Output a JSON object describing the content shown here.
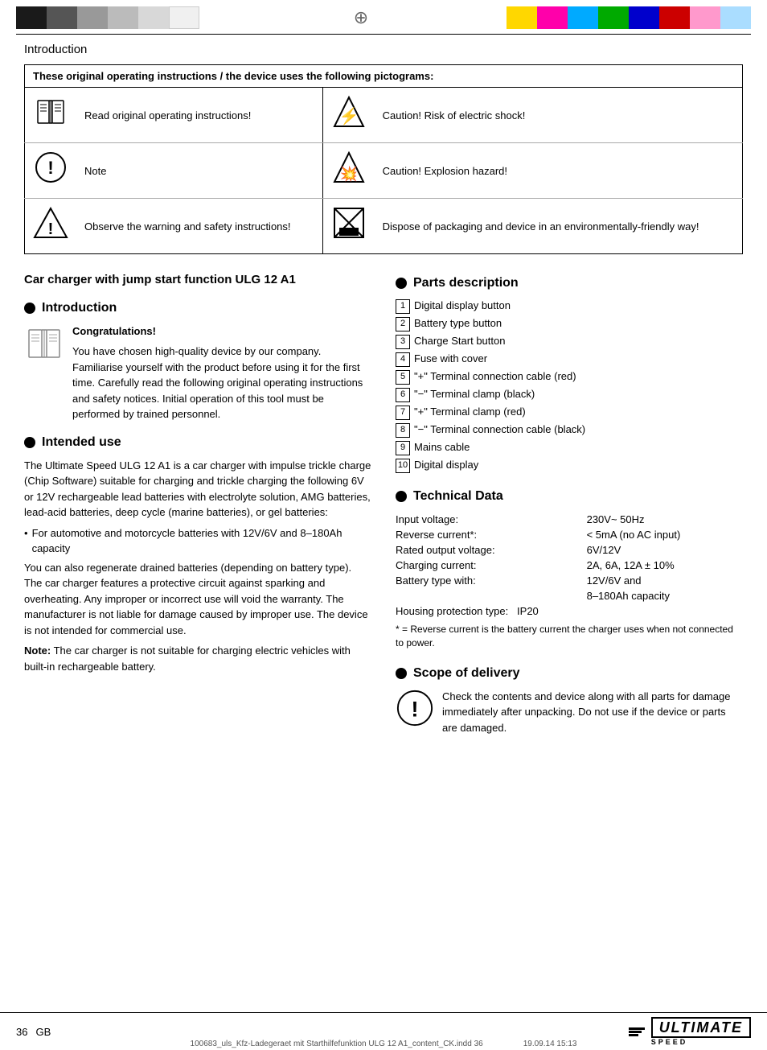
{
  "colorbar": {
    "title": "Color registration bar"
  },
  "header": {
    "section": "Introduction"
  },
  "pictogram_table": {
    "header": "These original operating instructions / the device uses the following pictograms:",
    "items": [
      {
        "icon": "book",
        "left_text": "Read original operating instructions!",
        "icon_right": "electric",
        "right_text": "Caution! Risk of electric shock!"
      },
      {
        "icon": "exclaim",
        "left_text": "Note",
        "icon_right": "explosion",
        "right_text": "Caution! Explosion hazard!"
      },
      {
        "icon": "warning",
        "left_text": "Observe the warning and safety instructions!",
        "icon_right": "recycle",
        "right_text": "Dispose of packaging and device in an environmentally-friendly way!"
      }
    ]
  },
  "product": {
    "title": "Car charger with jump start function ULG 12 A1"
  },
  "introduction": {
    "section_label": "Introduction",
    "congratulations": "Congratulations!",
    "body": "You have chosen high-quality device by our company. Familiarise yourself with the product before using it for the first time. Carefully read the following original operating instructions and safety notices. Initial operation of this tool must be performed by trained personnel."
  },
  "intended_use": {
    "section_label": "Intended use",
    "paragraph1": "The Ultimate Speed ULG 12 A1 is a car charger with impulse trickle charge (Chip Software) suitable for charging and trickle charging the following 6V or 12V rechargeable lead batteries with electrolyte solution, AMG batteries, lead-acid batteries, deep cycle (marine batteries), or gel batteries:",
    "bullet1": "For automotive and motorcycle batteries with 12V/6V and 8–180Ah capacity",
    "paragraph2": "You can also regenerate drained batteries (depending on battery type). The car charger features a protective circuit against sparking and overheating. Any improper or incorrect use will void the warranty. The manufacturer is not liable for damage caused by improper use. The device is not intended for commercial use.",
    "note_label": "Note:",
    "note_text": "The car charger is not suitable for charging electric vehicles with built-in rechargeable battery."
  },
  "parts_description": {
    "section_label": "Parts description",
    "items": [
      {
        "num": "1",
        "text": "Digital display button"
      },
      {
        "num": "2",
        "text": "Battery type button"
      },
      {
        "num": "3",
        "text": "Charge Start button"
      },
      {
        "num": "4",
        "text": "Fuse with cover"
      },
      {
        "num": "5",
        "text": "\"+\" Terminal connection cable (red)"
      },
      {
        "num": "6",
        "text": "\"−\" Terminal clamp (black)"
      },
      {
        "num": "7",
        "text": "\"+\" Terminal clamp (red)"
      },
      {
        "num": "8",
        "text": "\"−\" Terminal connection cable (black)"
      },
      {
        "num": "9",
        "text": "Mains cable"
      },
      {
        "num": "10",
        "text": "Digital display"
      }
    ]
  },
  "technical_data": {
    "section_label": "Technical Data",
    "rows": [
      {
        "label": "Input voltage:",
        "value": "230V~ 50Hz"
      },
      {
        "label": "Reverse current*:",
        "value": "< 5mA (no AC input)"
      },
      {
        "label": "Rated output voltage:",
        "value": "6V/12V"
      },
      {
        "label": "Charging current:",
        "value": "2A, 6A, 12A ± 10%"
      },
      {
        "label": "Battery type with:",
        "value": "12V/6V and"
      },
      {
        "label": "",
        "value": "8–180Ah capacity"
      }
    ],
    "housing": "Housing protection type:   IP20",
    "note": "* = Reverse current is the battery current the charger uses when not connected to power."
  },
  "scope_of_delivery": {
    "section_label": "Scope of delivery",
    "text": "Check the contents and device along with all parts for damage immediately after unpacking. Do not use if the device or parts are damaged."
  },
  "footer": {
    "page_num": "36",
    "country": "GB",
    "brand": "ULTIMATE",
    "brand_sub": "SPEED",
    "file_info": "100683_uls_Kfz-Ladegeraet mit Starthilfefunktion ULG 12 A1_content_CK.indd   36",
    "date_info": "19.09.14   15:13"
  }
}
